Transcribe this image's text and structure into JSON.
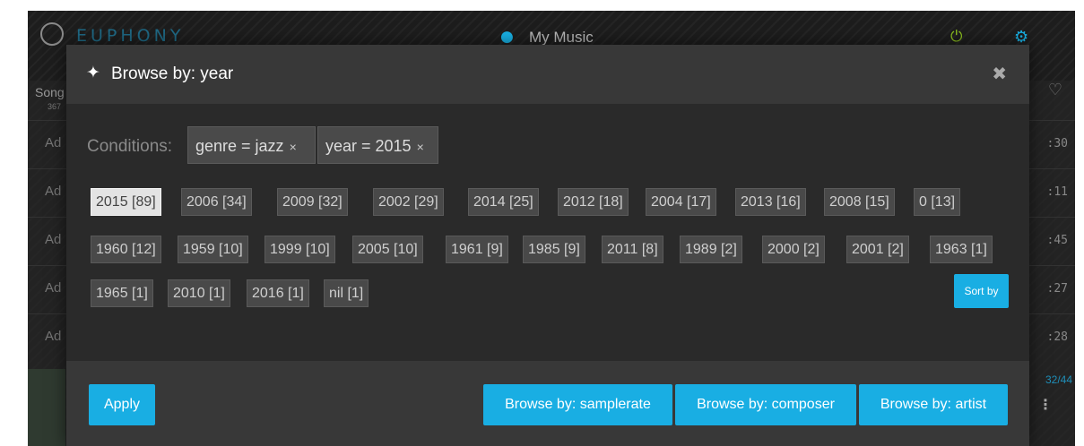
{
  "app": {
    "brand": "EUPHONY",
    "location": "My Music",
    "songs_label": "Song",
    "songs_count": "367",
    "row_prefix": "Ad",
    "row_times": [
      ":30",
      ":11",
      ":45",
      ":27",
      ":28"
    ],
    "queue_count": "32/44"
  },
  "modal": {
    "title": "Browse by: year",
    "conditions_label": "Conditions:",
    "conditions": [
      {
        "text": "genre = jazz",
        "remove": "×"
      },
      {
        "text": "year = 2015",
        "remove": "×"
      }
    ],
    "years": [
      "2015 [89]",
      "2006 [34]",
      "2009 [32]",
      "2002 [29]",
      "2014 [25]",
      "2012 [18]",
      "2004 [17]",
      "2013 [16]",
      "2008 [15]",
      "0 [13]",
      "1960 [12]",
      "1959 [10]",
      "1999 [10]",
      "2005 [10]",
      "1961 [9]",
      "1985 [9]",
      "2011 [8]",
      "1989 [2]",
      "2000 [2]",
      "2001 [2]",
      "1963 [1]",
      "1965 [1]",
      "2010 [1]",
      "2016 [1]",
      "nil [1]"
    ],
    "active_year": "2015 [89]",
    "sort_label": "Sort by",
    "apply_label": "Apply",
    "browse_buttons": [
      "Browse by: samplerate",
      "Browse by: composer",
      "Browse by: artist"
    ]
  },
  "colors": {
    "accent": "#19aee3",
    "power": "#8ec21f",
    "header_bg": "#383838",
    "body_bg": "#2a2a2a"
  }
}
